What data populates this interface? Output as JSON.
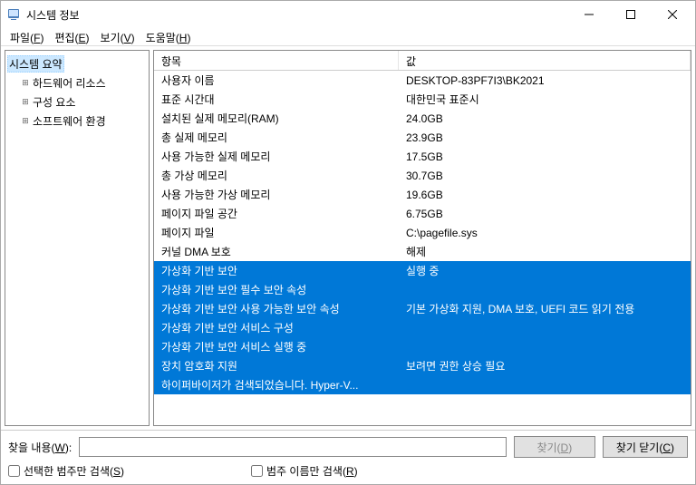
{
  "window": {
    "title": "시스템 정보"
  },
  "menu": {
    "file": "파일",
    "file_u": "F",
    "edit": "편집",
    "edit_u": "E",
    "view": "보기",
    "view_u": "V",
    "help": "도움말",
    "help_u": "H"
  },
  "tree": {
    "root": "시스템 요약",
    "hw": "하드웨어 리소스",
    "comp": "구성 요소",
    "sw": "소프트웨어 환경"
  },
  "list": {
    "header_item": "항목",
    "header_value": "값",
    "rows": [
      {
        "item": "사용자 이름",
        "value": "DESKTOP-83PF7I3\\BK2021",
        "sel": false
      },
      {
        "item": "표준 시간대",
        "value": "대한민국 표준시",
        "sel": false
      },
      {
        "item": "설치된 실제 메모리(RAM)",
        "value": "24.0GB",
        "sel": false
      },
      {
        "item": "총 실제 메모리",
        "value": "23.9GB",
        "sel": false
      },
      {
        "item": "사용 가능한 실제 메모리",
        "value": "17.5GB",
        "sel": false
      },
      {
        "item": "총 가상 메모리",
        "value": "30.7GB",
        "sel": false
      },
      {
        "item": "사용 가능한 가상 메모리",
        "value": "19.6GB",
        "sel": false
      },
      {
        "item": "페이지 파일 공간",
        "value": "6.75GB",
        "sel": false
      },
      {
        "item": "페이지 파일",
        "value": "C:\\pagefile.sys",
        "sel": false
      },
      {
        "item": "커널 DMA 보호",
        "value": "해제",
        "sel": false
      },
      {
        "item": "가상화 기반 보안",
        "value": "실행 중",
        "sel": true
      },
      {
        "item": "가상화 기반 보안 필수 보안 속성",
        "value": "",
        "sel": true
      },
      {
        "item": "가상화 기반 보안 사용 가능한 보안 속성",
        "value": "기본 가상화 지원, DMA 보호, UEFI 코드 읽기 전용",
        "sel": true
      },
      {
        "item": "가상화 기반 보안 서비스 구성",
        "value": "",
        "sel": true
      },
      {
        "item": "가상화 기반 보안 서비스 실행 중",
        "value": "",
        "sel": true
      },
      {
        "item": "장치 암호화 지원",
        "value": "보려면 권한 상승 필요",
        "sel": true
      },
      {
        "item": "하이퍼바이저가 검색되었습니다. Hyper-V...",
        "value": "",
        "sel": true
      }
    ]
  },
  "search": {
    "label": "찾을 내용",
    "label_u": "W",
    "find": "찾기",
    "find_u": "D",
    "close": "찾기 닫기",
    "close_u": "C",
    "chk_sel": "선택한 범주만 검색",
    "chk_sel_u": "S",
    "chk_name": "범주 이름만 검색",
    "chk_name_u": "R"
  }
}
